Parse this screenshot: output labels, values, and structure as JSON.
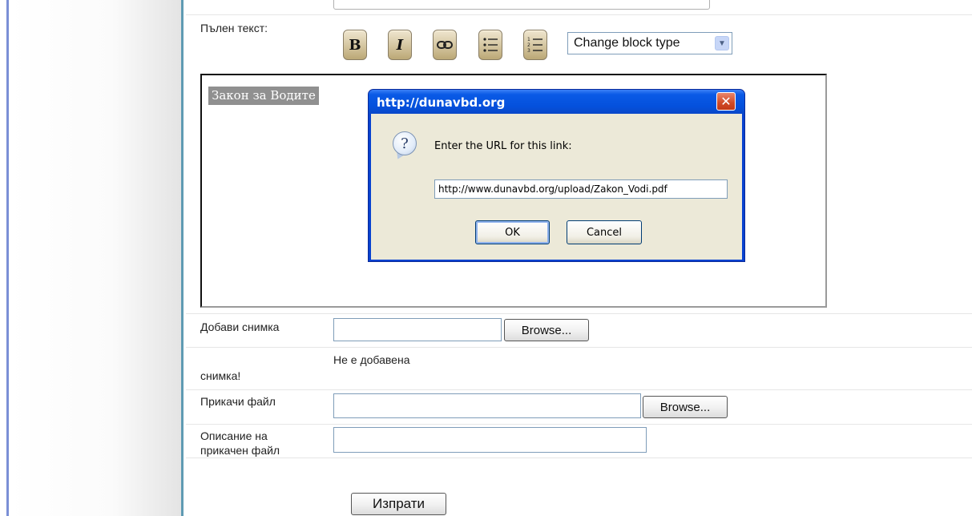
{
  "editor": {
    "label": "Пълен текст:",
    "selected_text": "Закон за Водите",
    "toolbar": {
      "bold_label": "B",
      "italic_label": "I",
      "link_icon": "link-icon",
      "bullet_list_icon": "bullet-list-icon",
      "numbered_list_icon": "numbered-list-icon",
      "block_type_value": "Change block type"
    }
  },
  "dialog": {
    "title": "http://dunavbd.org",
    "prompt": "Enter the URL for this link:",
    "url_value": "http://www.dunavbd.org/upload/Zakon_Vodi.pdf",
    "ok_label": "OK",
    "cancel_label": "Cancel",
    "close_glyph": "✕",
    "question_glyph": "?"
  },
  "form": {
    "photo_label": "Добави снимка",
    "photo_browse": "Browse...",
    "no_photo_line1": "Не е добавена",
    "no_photo_line2": "снимка!",
    "attach_label": "Прикачи файл",
    "attach_browse": "Browse...",
    "desc_label_line1": "Описание на",
    "desc_label_line2": "прикачен файл",
    "submit_label": "Изпрати"
  }
}
